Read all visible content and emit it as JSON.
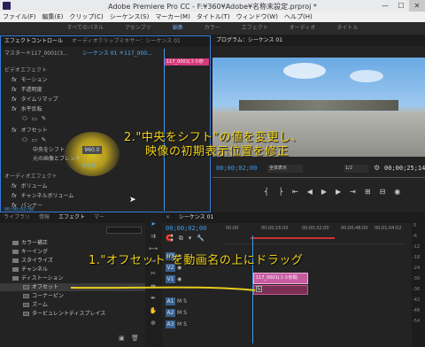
{
  "titlebar": {
    "title": "Adobe Premiere Pro CC - F:¥360¥Adobe¥名称未設定.prproj *",
    "minimize": "—",
    "maximize": "☐",
    "close": "✕"
  },
  "menu": [
    "ファイル(F)",
    "編集(E)",
    "クリップ(C)",
    "シーケンス(S)",
    "マーカー(M)",
    "タイトル(T)",
    "ウィンドウ(W)",
    "ヘルプ(H)"
  ],
  "workspaces": [
    "すべてのパネル",
    "アセンブリ",
    "編集",
    "カラー",
    "エフェクト",
    "オーディオ",
    "タイトル"
  ],
  "effect_controls": {
    "tabs": [
      "エフェクトコントロール",
      "オーディオクリップミキサー：シーケンス 01"
    ],
    "master": "マスター＊117_0001(3...",
    "sequence": "シーケンス 01 ＊117_000...",
    "clip": "117_0001(３０秒",
    "timecode": "00;00;02;00",
    "video_header": "ビデオエフェクト",
    "motion": "モーション",
    "opacity": "不透明度",
    "timeremap": "タイムリマップ",
    "hflip": "水平反転",
    "offset": "オフセット",
    "shift_center": "中央をシフト",
    "shift_value": "960.0",
    "blend": "元の画像とブレンド",
    "blend_value": "0.0%",
    "audio_header": "オーディオエフェクト",
    "volume": "ボリューム",
    "chvolume": "チャンネルボリューム",
    "panner": "パンナー"
  },
  "program": {
    "title": "プログラム：シーケンス 01",
    "timecode": "00;00;02;00",
    "fit": "全体表示",
    "ratio": "1/2",
    "duration": "00;00;25;14"
  },
  "effects_panel": {
    "tabs": [
      "ライブラリ",
      "情報",
      "エフェクト",
      "マー"
    ],
    "tree": [
      "カラー補正",
      "キーイング",
      "スタイライズ",
      "チャンネル",
      "ディストーション",
      "オフセット",
      "コーナーピン",
      "ズーム",
      "タービュレントディスプレイス"
    ]
  },
  "timeline": {
    "title": "シーケンス 01",
    "timecode": "00;00;02;00",
    "ruler": [
      "00;00",
      "00;00;16;00",
      "00;00;32;00",
      "00;00;48;00",
      "00;01;04;02"
    ],
    "tracks": [
      "V3",
      "V2",
      "V1",
      "A1",
      "A2",
      "A3"
    ],
    "clip_video": "117_0001(３０秒間",
    "meter": [
      "0",
      "-6",
      "-12",
      "-18",
      "-24",
      "-30",
      "-36",
      "-42",
      "-48",
      "-54"
    ]
  },
  "annotations": {
    "a1": "1.\"オフセット\"を動画名の上にドラッグ",
    "a2_line1": "2.\"中央をシフト\"の値を変更し、",
    "a2_line2": "映像の初期表示位置を修正"
  }
}
